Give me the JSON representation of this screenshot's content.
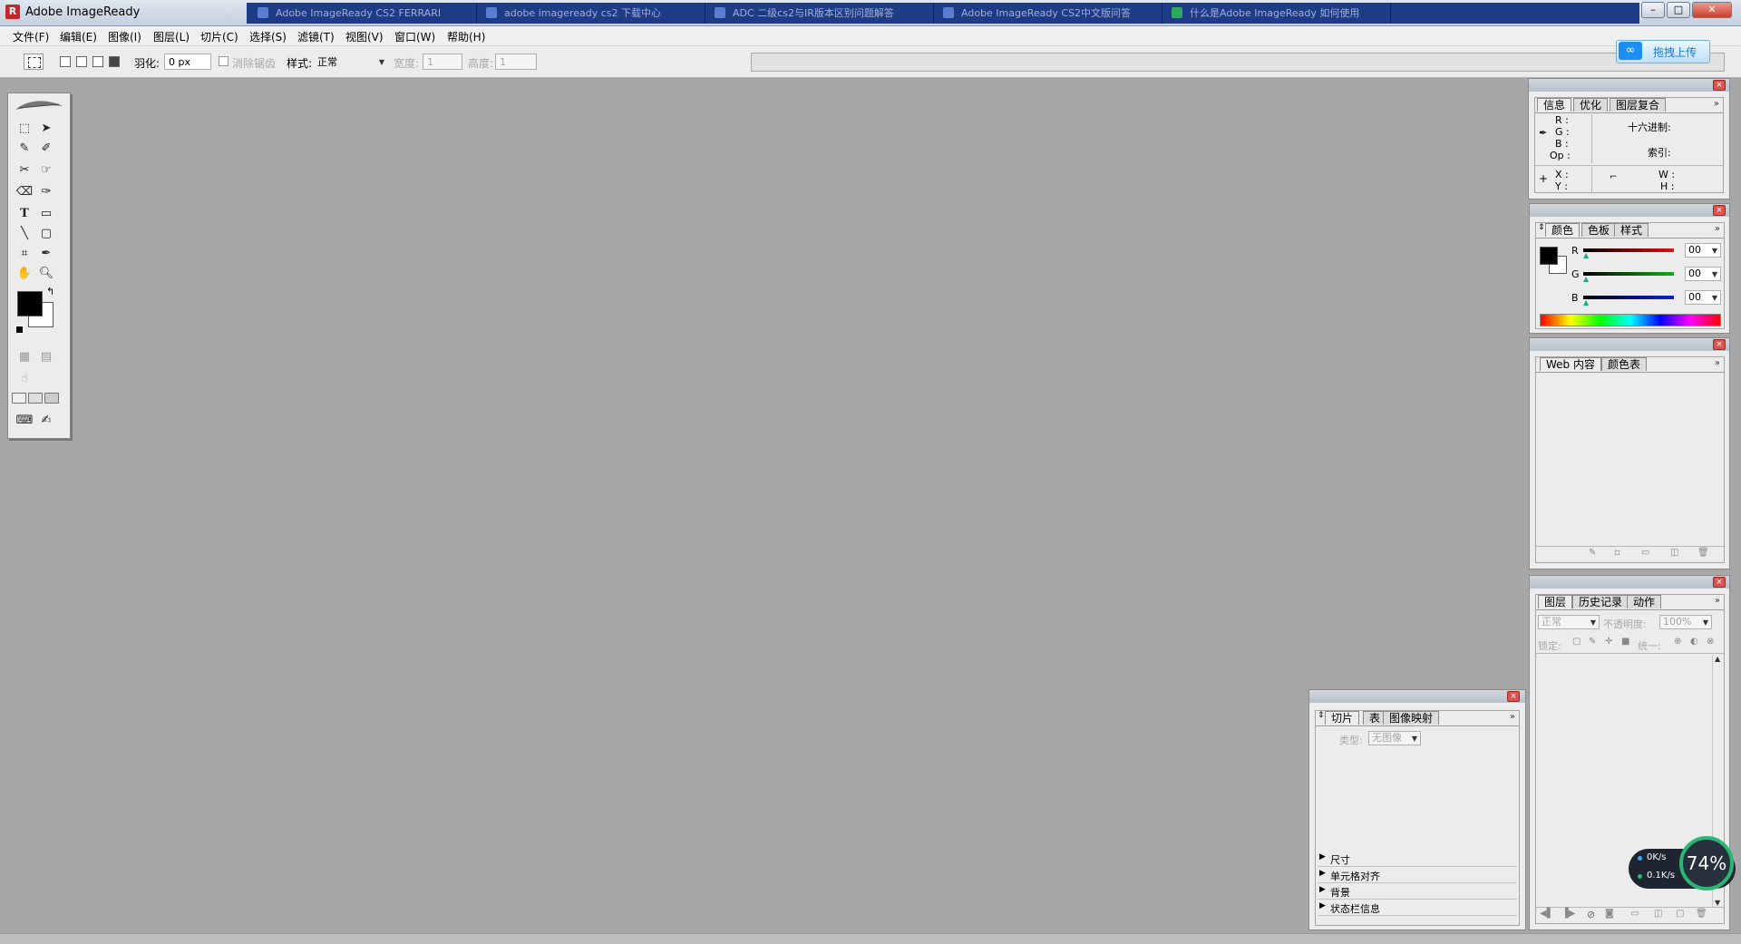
{
  "window": {
    "title": "Adobe ImageReady",
    "taskbar_tabs": [
      "Adobe ImageReady CS2 FERRARI",
      "adobe imageready cs2 下载中心",
      "ADC 二级cs2与IR版本区别问题解答",
      "Adobe ImageReady CS2中文版问答",
      "什么是Adobe ImageReady 如何使用"
    ],
    "controls": {
      "minimize": "–",
      "maximize": "□",
      "close": "✕"
    }
  },
  "menu": [
    "文件(F)",
    "编辑(E)",
    "图像(I)",
    "图层(L)",
    "切片(C)",
    "选择(S)",
    "滤镜(T)",
    "视图(V)",
    "窗口(W)",
    "帮助(H)"
  ],
  "options": {
    "feather_label": "羽化:",
    "feather_value": "0 px",
    "antialias_label": "消除锯齿",
    "style_label": "样式:",
    "style_value": "正常",
    "width_label": "宽度:",
    "width_value": "1",
    "height_label": "高度:",
    "height_value": "1"
  },
  "upload_button": "拖拽上传",
  "info_panel": {
    "tabs": [
      "信息",
      "优化",
      "图层复合"
    ],
    "r": "R :",
    "g": "G :",
    "b": "B :",
    "op": "Op :",
    "hex": "十六进制:",
    "index": "索引:",
    "x": "X :",
    "y": "Y :",
    "w": "W :",
    "h": "H :"
  },
  "color_panel": {
    "tabs": [
      "颜色",
      "色板",
      "样式"
    ],
    "channels": [
      {
        "name": "R",
        "value": "00",
        "color": "#e01010"
      },
      {
        "name": "G",
        "value": "00",
        "color": "#10b010"
      },
      {
        "name": "B",
        "value": "00",
        "color": "#1020d0"
      }
    ],
    "foreground": "#000000",
    "background": "#ffffff"
  },
  "web_panel": {
    "tabs": [
      "Web 内容",
      "颜色表"
    ]
  },
  "layers_panel": {
    "tabs": [
      "图层",
      "历史记录",
      "动作"
    ],
    "blend_mode": "正常",
    "opacity_label": "不透明度:",
    "opacity_value": "100%",
    "lock_label": "锁定:",
    "unify_label": "统一:"
  },
  "slice_panel": {
    "tabs": [
      "切片",
      "表",
      "图像映射"
    ],
    "type_label": "类型:",
    "type_value": "无图像",
    "sections": [
      "尺寸",
      "单元格对齐",
      "背景",
      "状态栏信息"
    ]
  },
  "network_widget": {
    "up": "0K/s",
    "down": "0.1K/s",
    "percent": "74%"
  }
}
